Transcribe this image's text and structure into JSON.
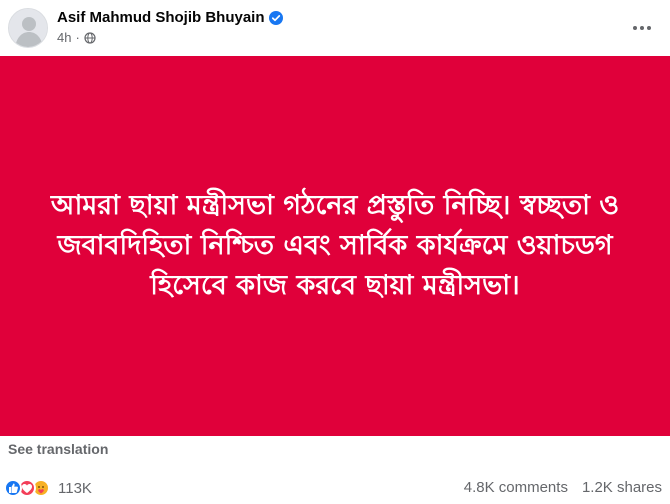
{
  "post": {
    "author_name": "Asif Mahmud Shojib Bhuyain",
    "verified_icon": "verified-badge-icon",
    "timestamp": "4h",
    "audience_icon": "globe-icon",
    "more_icon": "more-options-icon"
  },
  "media": {
    "background_color": "#e0003a",
    "text_color": "#ffffff",
    "text": "আমরা ছায়া মন্ত্রীসভা গঠনের প্রস্তুতি নিচ্ছি। স্বচ্ছতা ও জবাবদিহিতা নিশ্চিত এবং সার্বিক কার্যক্রমে ওয়াচডগ হিসেবে কাজ করবে ছায়া মন্ত্রীসভা।"
  },
  "actions": {
    "see_translation": "See translation"
  },
  "engagement": {
    "reaction_icons": [
      "like-icon",
      "love-icon",
      "care-icon"
    ],
    "reaction_count": "113K",
    "comments": "4.8K comments",
    "shares": "1.2K shares"
  },
  "colors": {
    "accent_blue": "#1877f2",
    "secondary_text": "#65676b"
  }
}
